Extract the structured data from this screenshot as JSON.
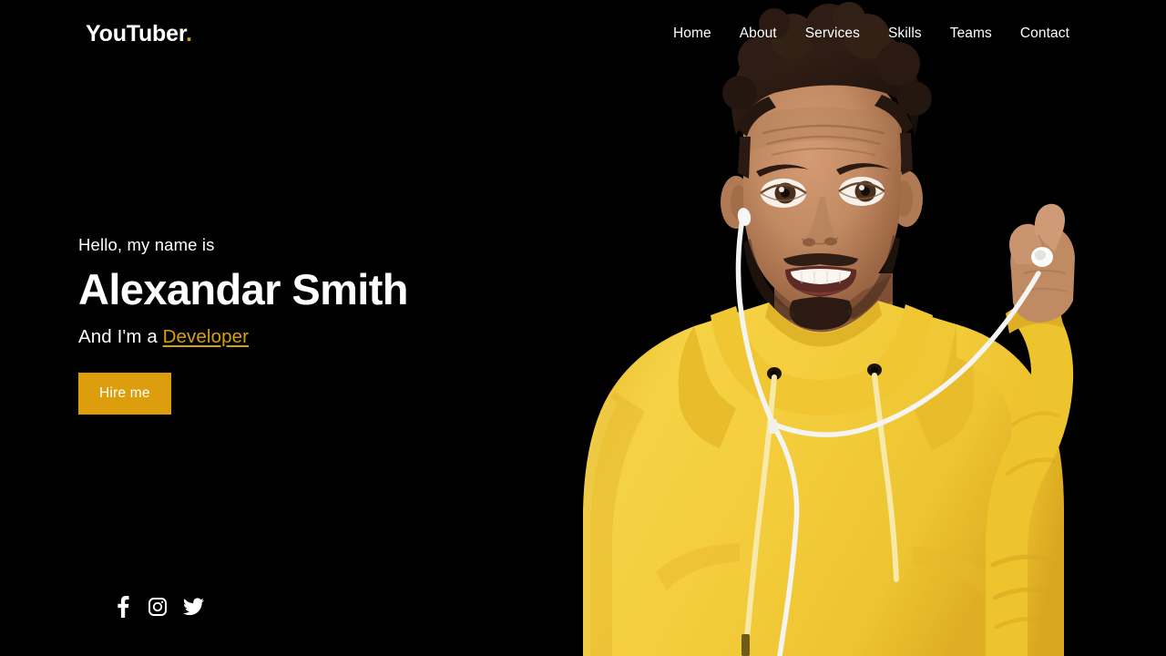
{
  "site": {
    "background_color": "#000000",
    "accent_color": "#dc9e0d"
  },
  "navbar": {
    "brand_name": "YouTuber",
    "brand_dot": ".",
    "links": [
      {
        "label": "Home"
      },
      {
        "label": "About"
      },
      {
        "label": "Services"
      },
      {
        "label": "Skills"
      },
      {
        "label": "Teams"
      },
      {
        "label": "Contact"
      }
    ]
  },
  "hero": {
    "greeting": "Hello, my name is",
    "name": "Alexandar Smith",
    "role_prefix": "And I'm a ",
    "role_highlight": "Developer",
    "cta_label": "Hire me",
    "photo": {
      "alt": "Man in yellow hoodie holding an earbud",
      "hoodie_color": "#f4ce3c",
      "hoodie_shadow_color": "#e0b52c",
      "skin_color": "#c08a63",
      "hair_color": "#2a1a14",
      "earphone_color": "#f2f2f2"
    }
  },
  "socials": [
    {
      "name": "facebook",
      "label": "Facebook"
    },
    {
      "name": "instagram",
      "label": "Instagram"
    },
    {
      "name": "twitter",
      "label": "Twitter"
    }
  ]
}
